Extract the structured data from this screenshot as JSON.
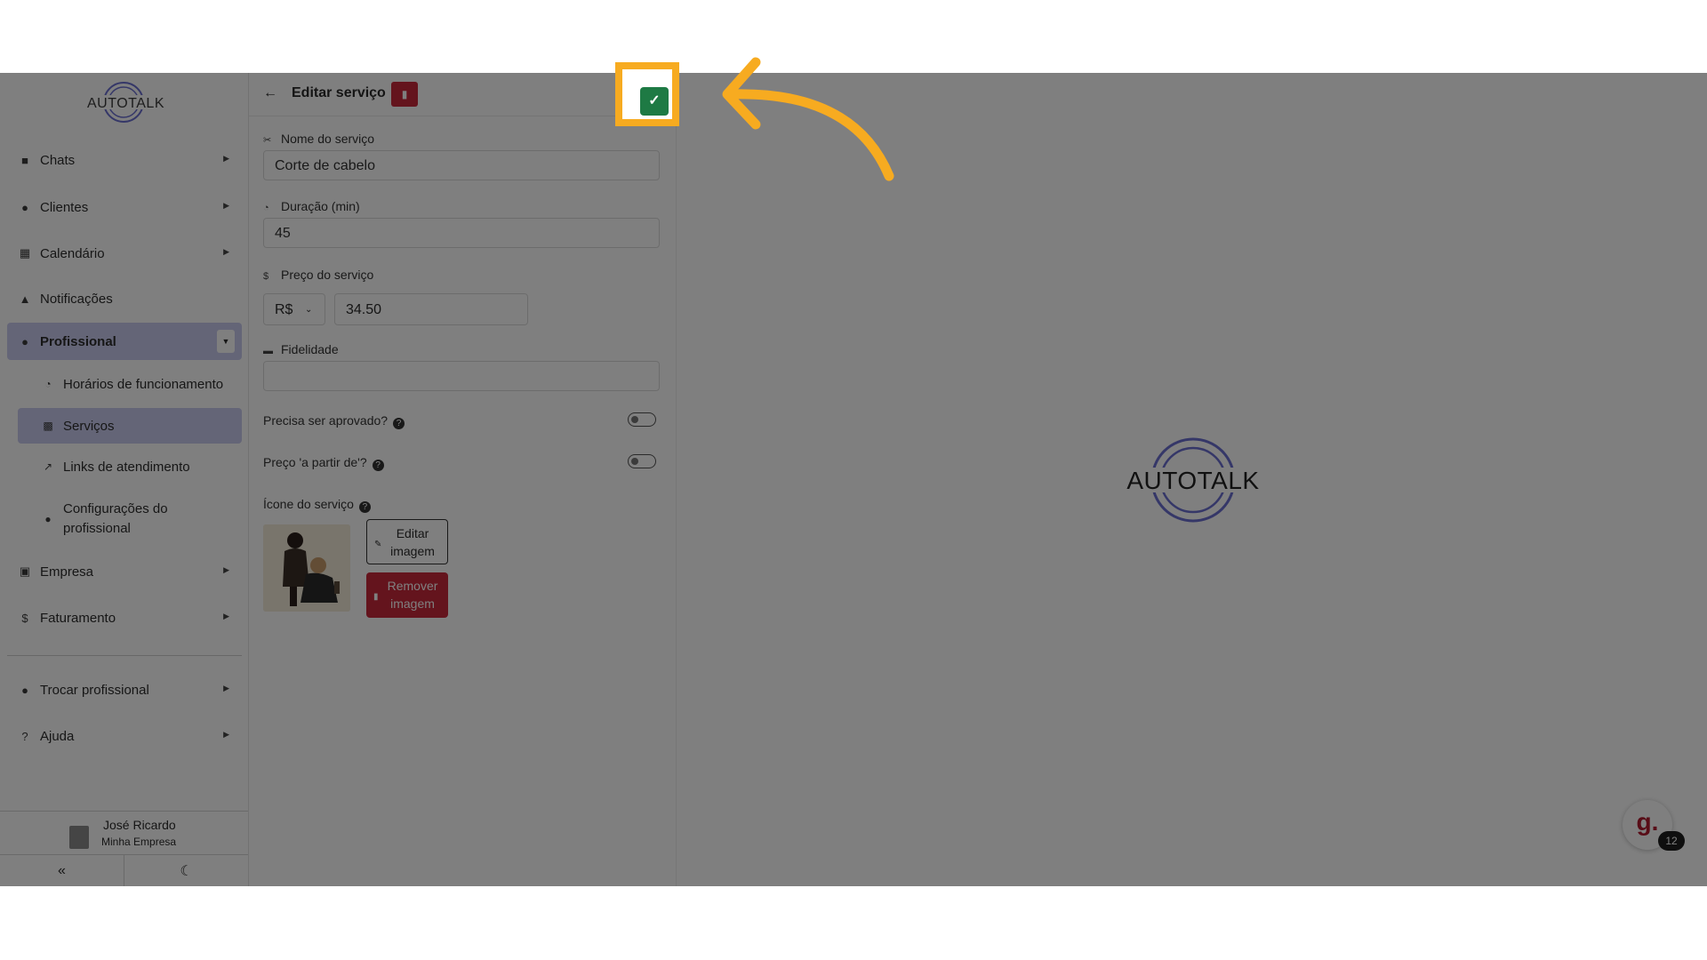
{
  "sidebar": {
    "logo_text": "AUTOTALK",
    "items": [
      {
        "label": "Chats",
        "icon": "chat-icon"
      },
      {
        "label": "Clientes",
        "icon": "users-icon"
      },
      {
        "label": "Calendário",
        "icon": "calendar-icon"
      },
      {
        "label": "Notificações",
        "icon": "bell-icon"
      },
      {
        "label": "Profissional",
        "icon": "user-tie-icon"
      }
    ],
    "sub_items": [
      {
        "label": "Horários de funcionamento",
        "icon": "clock-icon"
      },
      {
        "label": "Serviços",
        "icon": "clipboard-icon"
      },
      {
        "label": "Links de atendimento",
        "icon": "external-link-icon"
      },
      {
        "label": "Configurações do profissional",
        "icon": "user-gear-icon"
      }
    ],
    "items_after": [
      {
        "label": "Empresa",
        "icon": "building-icon"
      },
      {
        "label": "Faturamento",
        "icon": "dollar-icon"
      }
    ],
    "bottom_items": [
      {
        "label": "Trocar profissional",
        "icon": "users-swap-icon"
      },
      {
        "label": "Ajuda",
        "icon": "help-icon"
      }
    ],
    "user": {
      "name": "José Ricardo",
      "company": "Minha Empresa"
    }
  },
  "panel": {
    "title": "Editar serviço",
    "service_name_label": "Nome do serviço",
    "service_name_value": "Corte de cabelo",
    "duration_label": "Duração (min)",
    "duration_value": "45",
    "price_label": "Preço do serviço",
    "currency": "R$",
    "price_value": "34.50",
    "loyalty_label": "Fidelidade",
    "loyalty_value": "",
    "approval_label": "Precisa ser aprovado?",
    "approval_on": false,
    "price_from_label": "Preço 'a partir de'?",
    "price_from_on": false,
    "icon_label": "Ícone do serviço",
    "edit_image_label": "Editar imagem",
    "remove_image_label": "Remover imagem"
  },
  "content": {
    "logo_text": "AUTOTALK",
    "chat_fab_letter": "g.",
    "chat_badge_count": "12"
  },
  "colors": {
    "accent": "#c8caee",
    "danger": "#c9283b",
    "confirm": "#1e7a44",
    "highlight": "#f7ab20"
  }
}
